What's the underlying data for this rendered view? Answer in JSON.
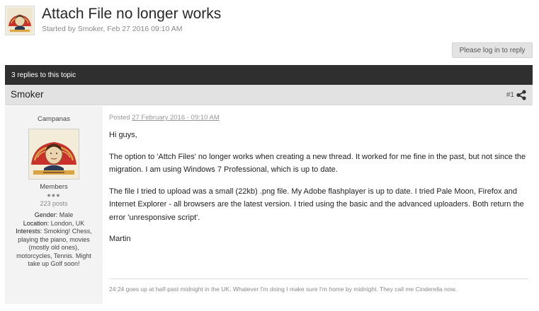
{
  "topic": {
    "title": "Attach File no longer works",
    "meta": "Started by Smoker, Feb 27 2016 09:10 AM",
    "login_button": "Please log in to reply",
    "replies_label": "3 replies to this topic"
  },
  "post": {
    "author": "Smoker",
    "number": "#1",
    "posted_prefix": "Posted",
    "posted_date": "27 February 2016 - 09:10 AM",
    "paragraphs": [
      "Hi guys,",
      "The option to 'Attch Files' no longer works when creating a new thread.  It worked for me fine in the past, but not since the migration.  I am using Windows 7 Professional, which is up to date.",
      "The file I tried to upload was a small (22kb) .png file.  My Adobe flashplayer is up to date.  I tried Pale Moon, Firefox and Internet Explorer - all browsers are the latest version.  I tried using the basic and the advanced uploaders.  Both return the error 'unresponsive script'.",
      "Martin"
    ],
    "signature": "24:24 goes up at half-past midnight in the UK.  Whatever I'm doing I make sure I'm home by midnight.  They call me Cinderella now."
  },
  "user": {
    "title": "Campanas",
    "group": "Members",
    "pips": "●●●",
    "post_count": "223 posts",
    "gender_label": "Gender:",
    "gender": "Male",
    "location_label": "Location:",
    "location": "London, UK",
    "interests_label": "Interests:",
    "interests": "Smoking! Chess, playing the piano, movies (mostly old ones), motorcycles, Tennis. Might take up Golf soon!"
  },
  "icons": {
    "avatar": "cigar-band-portrait-icon",
    "share": "share-icon"
  },
  "colors": {
    "replies_bar": "#2f2f2f",
    "post_header": "#e2e2e2",
    "sidebar": "#f3f3f3"
  }
}
